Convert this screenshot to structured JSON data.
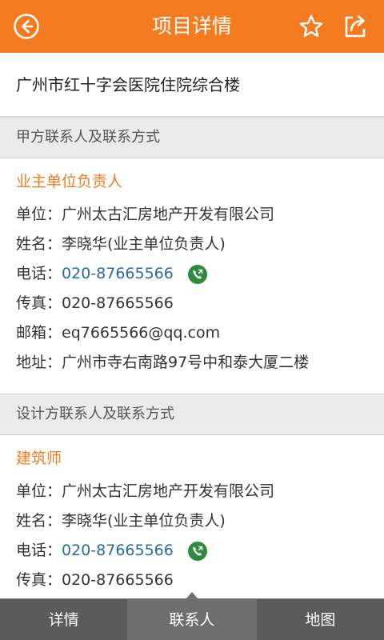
{
  "header": {
    "title": "项目详情",
    "back_icon": "back-circle-arrow-icon",
    "star_icon": "star-outline-icon",
    "share_icon": "share-external-icon",
    "accent_color": "#f47b20"
  },
  "project": {
    "name": "广州市红十字会医院住院综合楼"
  },
  "sections": [
    {
      "header": "甲方联系人及联系方式",
      "role": "业主单位负责人",
      "unit": "单位：广州太古汇房地产开发有限公司",
      "name": "姓名：李晓华(业主单位负责人)",
      "phone_label": "电话：",
      "phone": "020-87665566",
      "fax": "传真：020-87665566",
      "email": "邮箱：eq7665566@qq.com",
      "address": "地址：广州市寺右南路97号中和泰大厦二楼"
    },
    {
      "header": "设计方联系人及联系方式",
      "role": "建筑师",
      "unit": "单位：广州太古汇房地产开发有限公司",
      "name": "姓名：李晓华(业主单位负责人)",
      "phone_label": "电话：",
      "phone": "020-87665566",
      "fax": "传真：020-87665566"
    }
  ],
  "bottom_nav": {
    "tabs": [
      "详情",
      "联系人",
      "地图"
    ],
    "active": "联系人"
  }
}
